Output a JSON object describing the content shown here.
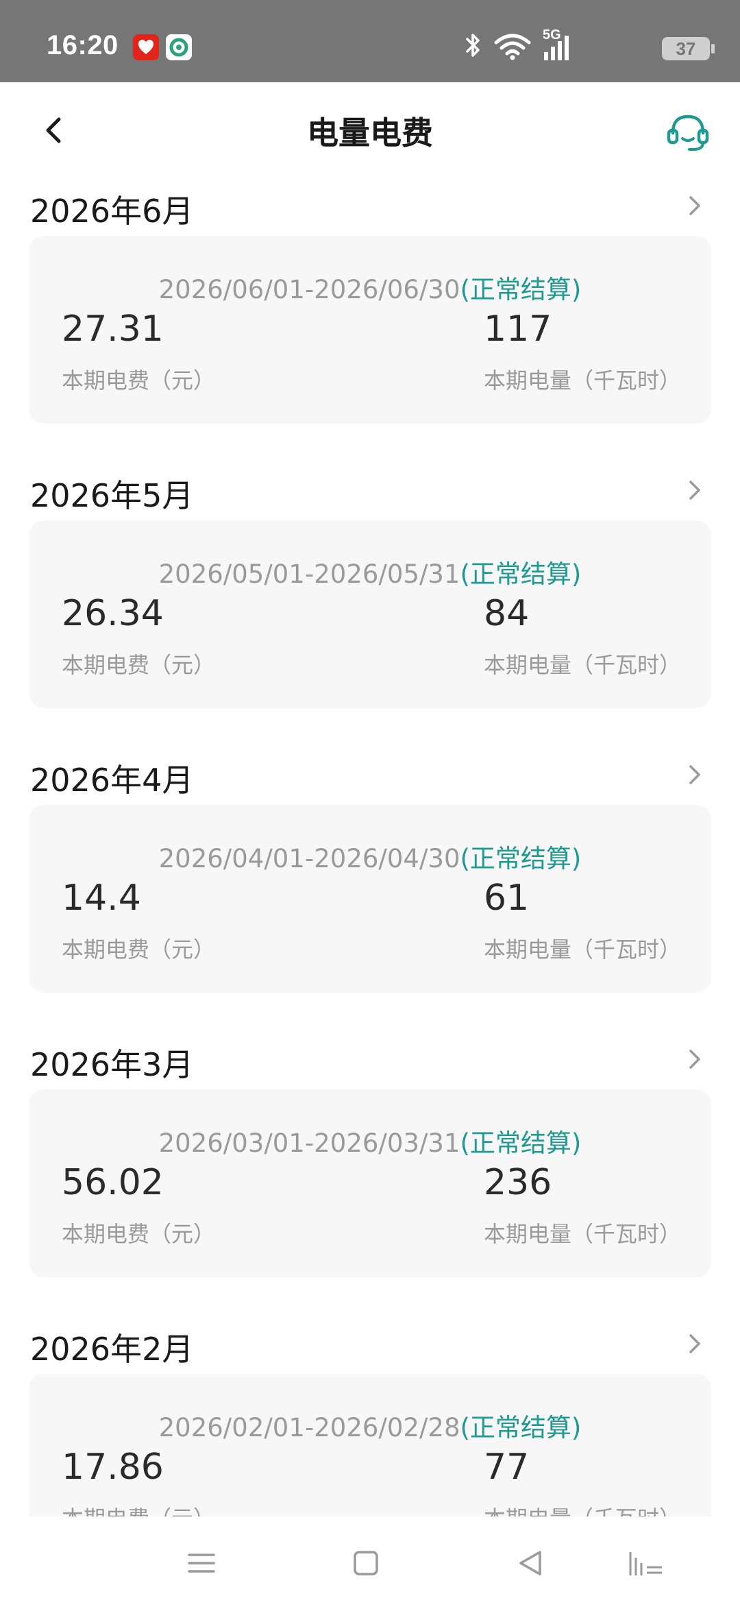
{
  "status_bar": {
    "time": "16:20",
    "network": "5G",
    "battery": "37",
    "icons": [
      "pinduoduo-icon",
      "app-icon",
      "bluetooth-icon",
      "wifi-icon",
      "signal-icon",
      "battery-icon"
    ]
  },
  "header": {
    "title": "电量电费",
    "back_icon": "chevron-left-icon",
    "service_icon": "headset-icon"
  },
  "labels": {
    "fee_label": "本期电费（元）",
    "usage_label": "本期电量（千瓦时）",
    "settlement_status": "(正常结算)"
  },
  "months": [
    {
      "title": "2026年6月",
      "period": "2026/06/01-2026/06/30",
      "status": "(正常结算)",
      "fee": "27.31",
      "usage": "117"
    },
    {
      "title": "2026年5月",
      "period": "2026/05/01-2026/05/31",
      "status": "(正常结算)",
      "fee": "26.34",
      "usage": "84"
    },
    {
      "title": "2026年4月",
      "period": "2026/04/01-2026/04/30",
      "status": "(正常结算)",
      "fee": "14.4",
      "usage": "61"
    },
    {
      "title": "2026年3月",
      "period": "2026/03/01-2026/03/31",
      "status": "(正常结算)",
      "fee": "56.02",
      "usage": "236"
    },
    {
      "title": "2026年2月",
      "period": "2026/02/01-2026/02/28",
      "status": "(正常结算)",
      "fee": "17.86",
      "usage": "77"
    }
  ],
  "colors": {
    "accent": "#1f9a90",
    "status_bar": "#767676",
    "card_bg": "#f7f7f7",
    "muted_text": "#9a9a9a"
  },
  "nav_bar": {
    "icons": [
      "menu-icon",
      "home-square-icon",
      "back-triangle-icon",
      "accessibility-icon"
    ]
  }
}
